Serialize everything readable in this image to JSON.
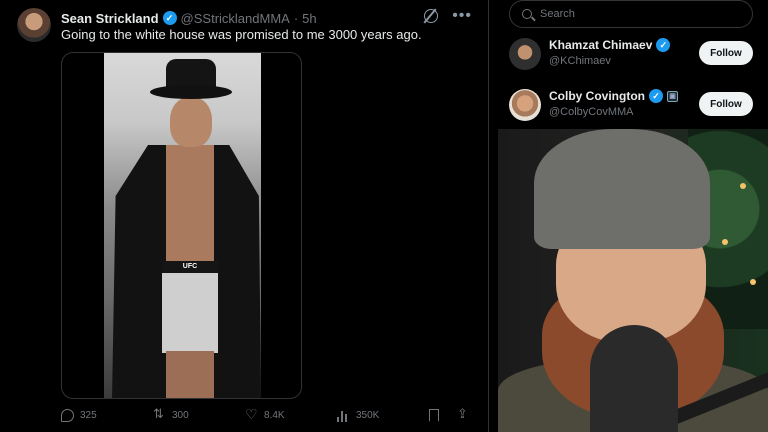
{
  "tweet": {
    "author_name": "Sean Strickland",
    "handle": "@SStricklandMMA",
    "separator": "·",
    "time": "5h",
    "text": "Going to the white house was promised to me 3000 years ago.",
    "more_glyph": "•••",
    "media_shorts_text": "UFC",
    "stats": {
      "replies": "325",
      "reposts": "300",
      "likes": "8.4K",
      "views": "350K"
    }
  },
  "sidebar": {
    "search": {
      "placeholder": "Search"
    },
    "who_to_follow": [
      {
        "name": "Khamzat Chimaev",
        "handle": "@KChimaev",
        "button": "Follow"
      },
      {
        "name": "Colby Covington",
        "handle": "@ColbyCovMMA",
        "button": "Follow"
      }
    ]
  },
  "colors": {
    "background": "#000000",
    "text_primary": "#e7e9ea",
    "text_secondary": "#71767b",
    "verified_blue": "#1d9bf0",
    "follow_button_bg": "#eff3f4",
    "border": "#2f3336"
  },
  "icons": [
    "verified-icon",
    "grok-icon",
    "more-icon",
    "reply-icon",
    "repost-icon",
    "like-icon",
    "views-icon",
    "bookmark-icon",
    "share-icon",
    "search-icon",
    "affiliate-badge-icon"
  ]
}
